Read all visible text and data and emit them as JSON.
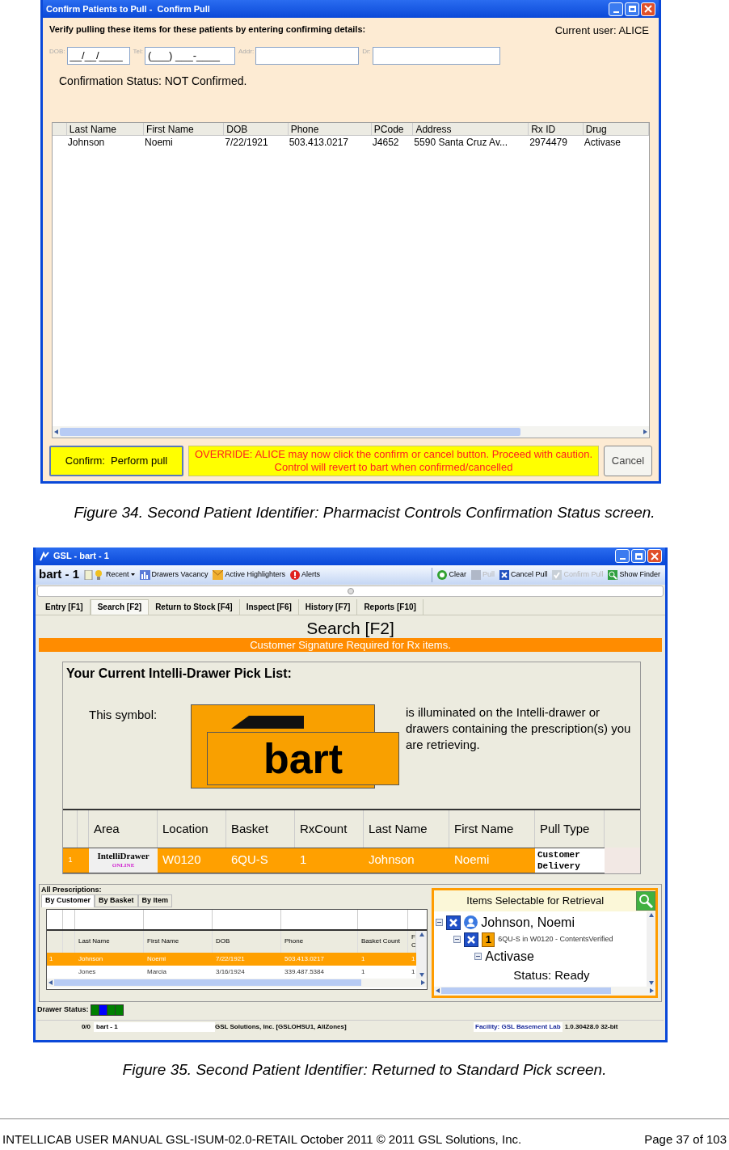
{
  "figure_34": {
    "window": {
      "title": "Confirm Patients to Pull -  Confirm Pull"
    },
    "instruction": "Verify pulling these items for these patients by entering confirming details:",
    "current_user": "Current user: ALICE",
    "fields": [
      {
        "label": "DOB:",
        "value": "__/__/____"
      },
      {
        "label": "Tel:",
        "value": "(___) ___-____"
      },
      {
        "label": "Addr:"
      },
      {
        "label": "Dr:"
      }
    ],
    "confirmation_status": "Confirmation Status: NOT Confirmed.",
    "table": {
      "columns": [
        "Last Name",
        "First Name",
        "DOB",
        "Phone",
        "PCode",
        "Address",
        "Rx ID",
        "Drug"
      ],
      "rows": [
        [
          "Johnson",
          "Noemi",
          "7/22/1921",
          "503.413.0217",
          "J4652",
          "5590 Santa Cruz Av...",
          "2974479",
          "Activase"
        ]
      ]
    },
    "confirm_button": "Confirm:  Perform pull",
    "override_message": "OVERRIDE: ALICE may now click the confirm or cancel button. Proceed with caution. Control will revert to bart when confirmed/cancelled",
    "cancel_button": "Cancel",
    "caption": "Figure 34. Second Patient Identifier: Pharmacist Controls Confirmation Status screen."
  },
  "figure_35": {
    "window": {
      "title": "GSL - bart - 1"
    },
    "toolbar": {
      "user": "bart - 1",
      "items": [
        {
          "label": "Recent",
          "kind": "dropdown",
          "disabled": false
        },
        {
          "label": "Drawers Vacancy",
          "kind": "chart",
          "disabled": false
        },
        {
          "label": "Active Highlighters",
          "kind": "highlighter",
          "disabled": false
        },
        {
          "label": "Alerts",
          "kind": "alert",
          "disabled": false
        }
      ],
      "actions": [
        {
          "label": "Clear",
          "kind": "clear",
          "disabled": false
        },
        {
          "label": "Pull",
          "kind": "pull",
          "disabled": true
        },
        {
          "label": "Cancel Pull",
          "kind": "cancel",
          "disabled": false
        },
        {
          "label": "Confirm Pull",
          "kind": "confirm",
          "disabled": true
        },
        {
          "label": "Show Finder",
          "kind": "finder",
          "disabled": false
        }
      ]
    },
    "tabs": [
      {
        "label": "Entry [F1]",
        "selected": false
      },
      {
        "label": "Search [F2]",
        "selected": true
      },
      {
        "label": "Return to Stock [F4]",
        "selected": false
      },
      {
        "label": "Inspect [F6]",
        "selected": false
      },
      {
        "label": "History [F7]",
        "selected": false
      },
      {
        "label": "Reports [F10]",
        "selected": false
      }
    ],
    "heading": "Search [F2]",
    "banner": "Customer Signature Required for Rx items.",
    "pick_list": {
      "title": "Your Current Intelli-Drawer Pick List:",
      "symbol_label": "This symbol:",
      "symbol_text": "bart",
      "description": "is illuminated on the Intelli-drawer or drawers containing the prescription(s) you are retrieving.",
      "columns": [
        "Area",
        "Location",
        "Basket",
        "RxCount",
        "Last Name",
        "First Name",
        "Pull Type"
      ],
      "rows": [
        {
          "index": "1",
          "cells": [
            {
              "kind": "logo",
              "text": "IntelliDrawer",
              "subtext": "ONLINE"
            },
            {
              "kind": "text",
              "text": "W0120"
            },
            {
              "kind": "text",
              "text": "6QU-S"
            },
            {
              "kind": "text",
              "text": "1"
            },
            {
              "kind": "text",
              "text": "Johnson"
            },
            {
              "kind": "text",
              "text": "Noemi"
            },
            {
              "kind": "mono",
              "text": "Customer Delivery"
            }
          ],
          "selected": true
        }
      ]
    },
    "all_prescriptions": {
      "label": "All Prescriptions:",
      "tabs": [
        {
          "label": "By Customer",
          "selected": true
        },
        {
          "label": "By Basket",
          "selected": false
        },
        {
          "label": "By Item",
          "selected": false
        }
      ],
      "columns": [
        "Last Name",
        "First Name",
        "DOB",
        "Phone",
        "Basket Count",
        "F C"
      ],
      "rows": [
        {
          "index": "1",
          "cells": [
            "Johnson",
            "Noemi",
            "7/22/1921",
            "503.413.0217",
            "1",
            "1"
          ],
          "selected": true
        },
        {
          "cells": [
            "Jones",
            "Marcia",
            "3/16/1924",
            "339.487.5384",
            "1",
            "1"
          ],
          "selected": false
        }
      ]
    },
    "retrieval": {
      "title": "Items Selectable for Retrieval",
      "tree": [
        {
          "label": "Johnson, Noemi",
          "kind": "customer",
          "checked": true,
          "expanded": true,
          "children": [
            {
              "label": "6QU-S in W0120 - ContentsVerified",
              "kind": "basket",
              "badge": "1",
              "checked": true,
              "expanded": true,
              "children": [
                {
                  "label": "Activase",
                  "kind": "item",
                  "expanded": true,
                  "children": [
                    {
                      "label": "Status: Ready",
                      "kind": "status"
                    }
                  ]
                }
              ]
            }
          ]
        }
      ]
    },
    "drawer_status": {
      "label": "Drawer Status:",
      "cells": [
        {
          "color": "#008000"
        },
        {
          "color": "#0000ff"
        },
        {
          "color": "#008000"
        },
        {
          "color": "#008000"
        }
      ]
    },
    "status_bar": {
      "count": "0/0",
      "user": "bart - 1",
      "company": "GSL Solutions, Inc. [GSLOHSU1, AllZones]",
      "facility": "Facility: GSL Basement Lab",
      "version": "1.0.30428.0 32-bit"
    },
    "caption": "Figure 35. Second Patient Identifier: Returned to Standard Pick screen."
  },
  "footer": {
    "left": "INTELLICAB USER MANUAL GSL-ISUM-02.0-RETAIL October 2011 © 2011 GSL Solutions, Inc.",
    "right": "Page 37 of 103"
  }
}
